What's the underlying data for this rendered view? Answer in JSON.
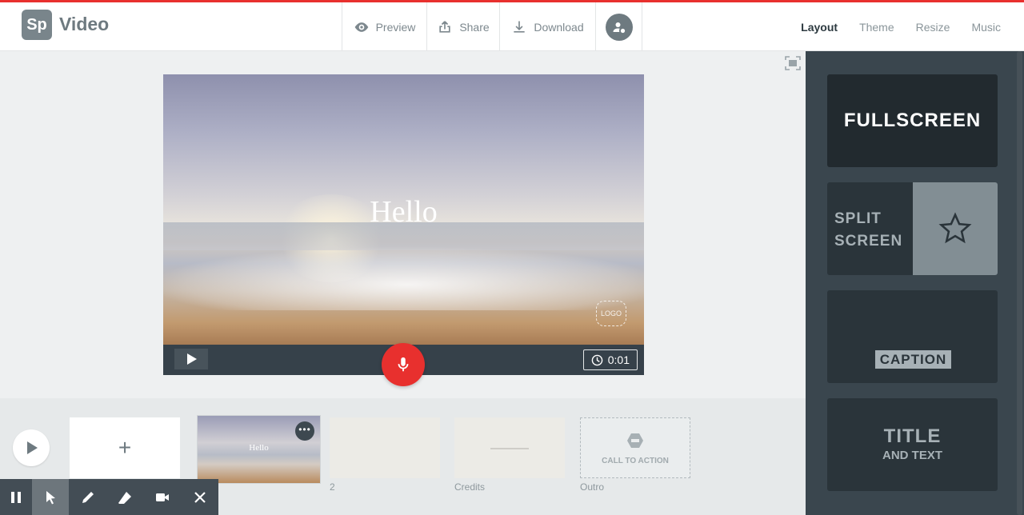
{
  "app": {
    "logo_text": "Sp",
    "name": "Video"
  },
  "header": {
    "preview_label": "Preview",
    "share_label": "Share",
    "download_label": "Download"
  },
  "tabs": [
    {
      "label": "Layout",
      "active": true
    },
    {
      "label": "Theme",
      "active": false
    },
    {
      "label": "Resize",
      "active": false
    },
    {
      "label": "Music",
      "active": false
    }
  ],
  "stage": {
    "slide_text": "Hello",
    "logo_placeholder": "LOGO",
    "timer": "0:01"
  },
  "timeline": {
    "add_label": "+",
    "thumb_hello": "Hello",
    "thumb_menu": "•••",
    "cta_label": "CALL TO ACTION",
    "captions": [
      "2",
      "Credits",
      "Outro"
    ]
  },
  "layouts": {
    "fullscreen": "FULLSCREEN",
    "split_line1": "SPLIT",
    "split_line2": "SCREEN",
    "caption": "CAPTION",
    "title_big": "TITLE",
    "title_small": "AND TEXT"
  },
  "icons": [
    "eye-icon",
    "share-icon",
    "download-icon",
    "user-icon",
    "fit-screen-icon",
    "play-icon",
    "clock-icon",
    "microphone-icon",
    "star-icon",
    "pause-icon",
    "cursor-icon",
    "pen-icon",
    "eraser-icon",
    "video-camera-icon",
    "close-icon"
  ],
  "colors": {
    "accent": "#e8302e",
    "sidebar": "#3a464e",
    "brand_gray": "#79858b"
  }
}
